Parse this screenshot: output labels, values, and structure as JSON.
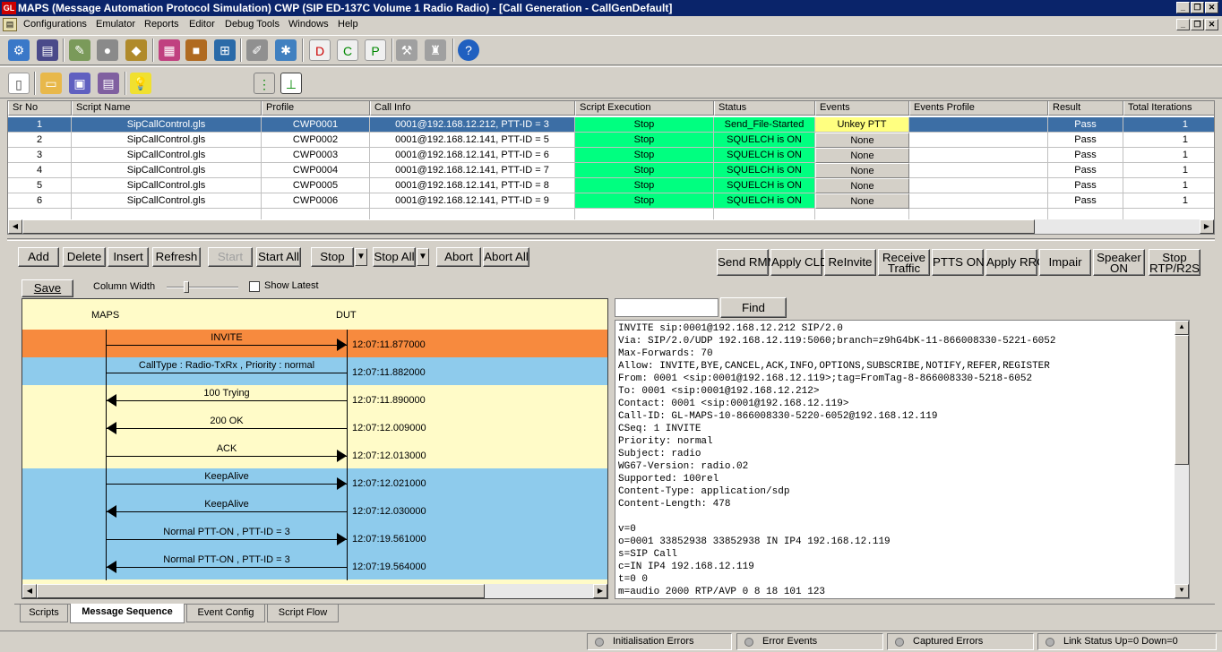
{
  "window": {
    "title": "MAPS (Message Automation Protocol Simulation) CWP (SIP ED-137C Volume 1 Radio Radio) - [Call Generation  - CallGenDefault]",
    "app_icon": "GL"
  },
  "menu": [
    "Configurations",
    "Emulator",
    "Reports",
    "Editor",
    "Debug Tools",
    "Windows",
    "Help"
  ],
  "toolbar1_icons": [
    "gear-icon",
    "notes-icon",
    "edit-icon",
    "run-icon",
    "profile-icon",
    "cubes-icon",
    "suitcase-icon",
    "network-icon",
    "pen-icon",
    "settings-icon",
    "doc-d-icon",
    "doc-c-icon",
    "doc-p-icon",
    "tools-icon",
    "stamp-icon",
    "help-icon"
  ],
  "toolbar2_icons": [
    "new-file-icon",
    "open-folder-icon",
    "save-icon",
    "save-as-icon",
    "lightbulb-icon",
    "vertical-layout-icon",
    "tree-layout-icon"
  ],
  "table": {
    "columns": [
      "Sr No",
      "Script Name",
      "Profile",
      "Call Info",
      "Script Execution",
      "Status",
      "Events",
      "Events Profile",
      "Result",
      "Total Iterations"
    ],
    "rows": [
      {
        "sr": "1",
        "script": "SipCallControl.gls",
        "profile": "CWP0001",
        "call": "0001@192.168.12.212, PTT-ID = 3",
        "exec": "Stop",
        "status": "Send_File-Started",
        "event": "Unkey PTT",
        "evprof": "",
        "result": "Pass",
        "iter": "1"
      },
      {
        "sr": "2",
        "script": "SipCallControl.gls",
        "profile": "CWP0002",
        "call": "0001@192.168.12.141, PTT-ID = 5",
        "exec": "Stop",
        "status": "SQUELCH is ON",
        "event": "None",
        "evprof": "",
        "result": "Pass",
        "iter": "1"
      },
      {
        "sr": "3",
        "script": "SipCallControl.gls",
        "profile": "CWP0003",
        "call": "0001@192.168.12.141, PTT-ID = 6",
        "exec": "Stop",
        "status": "SQUELCH is ON",
        "event": "None",
        "evprof": "",
        "result": "Pass",
        "iter": "1"
      },
      {
        "sr": "4",
        "script": "SipCallControl.gls",
        "profile": "CWP0004",
        "call": "0001@192.168.12.141, PTT-ID = 7",
        "exec": "Stop",
        "status": "SQUELCH is ON",
        "event": "None",
        "evprof": "",
        "result": "Pass",
        "iter": "1"
      },
      {
        "sr": "5",
        "script": "SipCallControl.gls",
        "profile": "CWP0005",
        "call": "0001@192.168.12.141, PTT-ID = 8",
        "exec": "Stop",
        "status": "SQUELCH is ON",
        "event": "None",
        "evprof": "",
        "result": "Pass",
        "iter": "1"
      },
      {
        "sr": "6",
        "script": "SipCallControl.gls",
        "profile": "CWP0006",
        "call": "0001@192.168.12.141, PTT-ID = 9",
        "exec": "Stop",
        "status": "SQUELCH is ON",
        "event": "None",
        "evprof": "",
        "result": "Pass",
        "iter": "1"
      }
    ]
  },
  "buttons": {
    "add": "Add",
    "delete": "Delete",
    "insert": "Insert",
    "refresh": "Refresh",
    "start": "Start",
    "start_all": "Start All",
    "stop": "Stop",
    "stop_all": "Stop All",
    "abort": "Abort",
    "abort_all": "Abort All",
    "send_rmm": "Send RMM",
    "apply_cld": "Apply CLD",
    "reinvite": "ReInvite",
    "receive_traffic_1": "Receive",
    "receive_traffic_2": "Traffic",
    "ptts_on": "PTTS ON",
    "apply_rrc": "Apply RRC",
    "impair": "Impair",
    "speaker_1": "Speaker",
    "speaker_2": "ON",
    "stop_rtp_1": "Stop",
    "stop_rtp_2": "RTP/R2S",
    "save": "Save",
    "find": "Find"
  },
  "options": {
    "column_width_label": "Column Width",
    "column_width_level": 0.25,
    "show_latest_label": "Show Latest",
    "show_latest_checked": false
  },
  "find_value": "",
  "sequence": {
    "left_header": "MAPS",
    "right_header": "DUT",
    "colors": {
      "orange": "#f78a3e",
      "blue": "#8ecbec",
      "yellow": "#fffbc8"
    },
    "messages": [
      {
        "label": "INVITE",
        "time": "12:07:11.877000",
        "dir": "right",
        "band": "orange"
      },
      {
        "label": "CallType : Radio-TxRx , Priority : normal",
        "time": "12:07:11.882000",
        "dir": "none",
        "band": "blue"
      },
      {
        "label": "100  Trying",
        "time": "12:07:11.890000",
        "dir": "left",
        "band": "yellow"
      },
      {
        "label": "200  OK",
        "time": "12:07:12.009000",
        "dir": "left",
        "band": "yellow"
      },
      {
        "label": "ACK",
        "time": "12:07:12.013000",
        "dir": "right",
        "band": "yellow"
      },
      {
        "label": "KeepAlive",
        "time": "12:07:12.021000",
        "dir": "right",
        "band": "blue"
      },
      {
        "label": "KeepAlive",
        "time": "12:07:12.030000",
        "dir": "left",
        "band": "blue"
      },
      {
        "label": "Normal PTT-ON , PTT-ID = 3",
        "time": "12:07:19.561000",
        "dir": "right",
        "band": "blue"
      },
      {
        "label": "Normal PTT-ON , PTT-ID = 3",
        "time": "12:07:19.564000",
        "dir": "left",
        "band": "blue"
      }
    ]
  },
  "message_text": [
    "INVITE sip:0001@192.168.12.212 SIP/2.0",
    "Via: SIP/2.0/UDP 192.168.12.119:5060;branch=z9hG4bK-11-866008330-5221-6052",
    "Max-Forwards: 70",
    "Allow: INVITE,BYE,CANCEL,ACK,INFO,OPTIONS,SUBSCRIBE,NOTIFY,REFER,REGISTER",
    "From: 0001 <sip:0001@192.168.12.119>;tag=FromTag-8-866008330-5218-6052",
    "To: 0001 <sip:0001@192.168.12.212>",
    "Contact: 0001 <sip:0001@192.168.12.119>",
    "Call-ID: GL-MAPS-10-866008330-5220-6052@192.168.12.119",
    "CSeq: 1 INVITE",
    "Priority: normal",
    "Subject: radio",
    "WG67-Version: radio.02",
    "Supported: 100rel",
    "Content-Type: application/sdp",
    "Content-Length: 478",
    "",
    "v=0",
    "o=0001 33852938 33852938 IN IP4 192.168.12.119",
    "s=SIP Call",
    "c=IN IP4 192.168.12.119",
    "t=0 0",
    "m=audio 2000 RTP/AVP 0 8 18 101 123"
  ],
  "tabs": [
    "Scripts",
    "Message Sequence",
    "Event Config",
    "Script Flow"
  ],
  "active_tab": "Message Sequence",
  "status_bar": [
    "Initialisation Errors",
    "Error Events",
    "Captured Errors",
    "Link Status Up=0 Down=0"
  ]
}
